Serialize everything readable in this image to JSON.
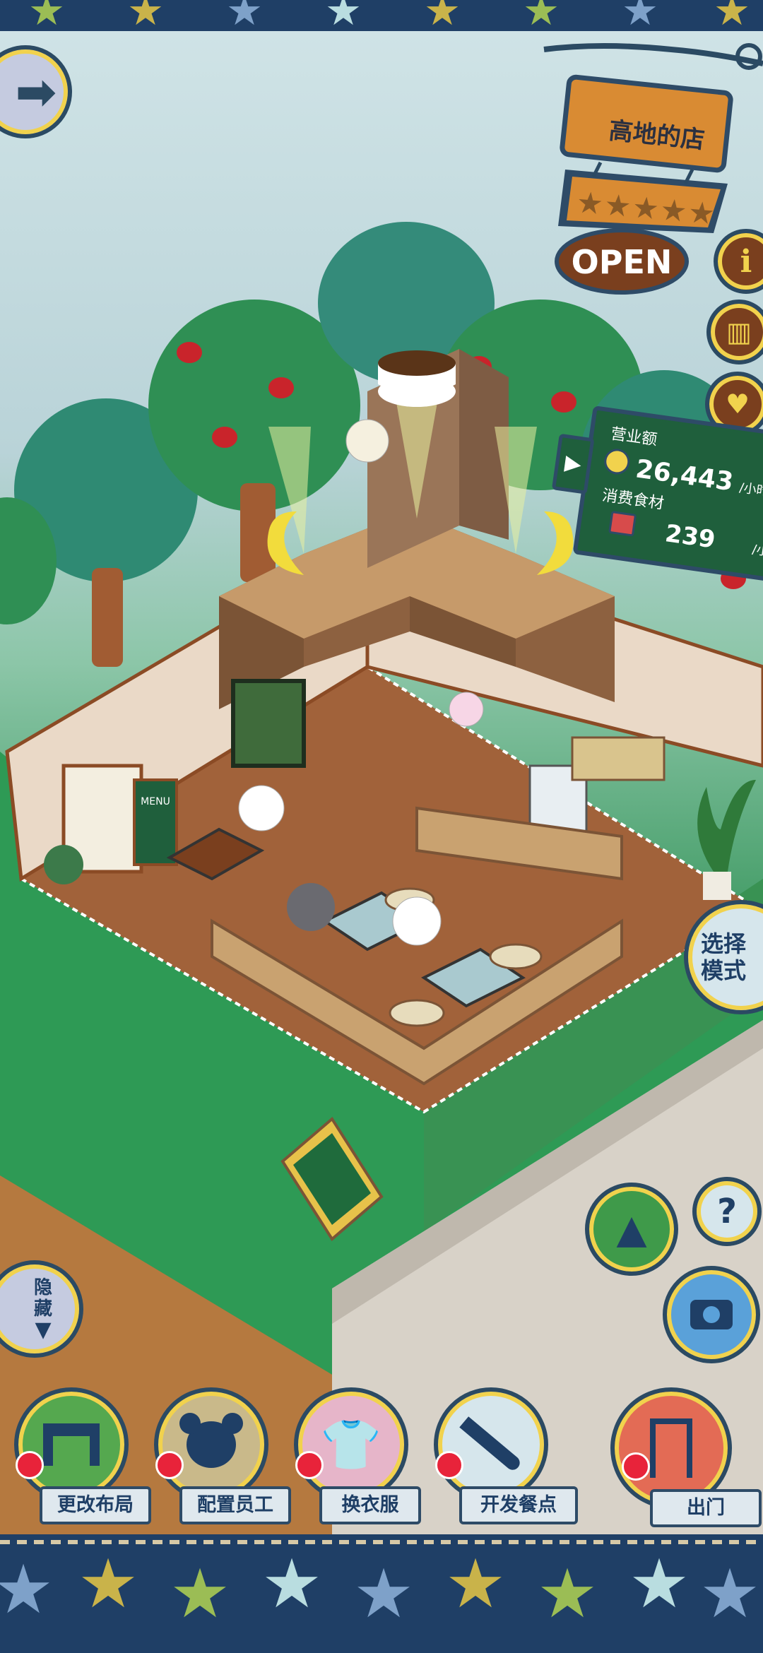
{
  "shop": {
    "name": "高地的店",
    "status": "OPEN",
    "stars": 5
  },
  "stats": {
    "revenue_label": "营业额",
    "revenue_value": "26,443",
    "revenue_unit": "/小时",
    "ingredients_label": "消费食材",
    "ingredients_value": "239",
    "ingredients_unit": "/小时"
  },
  "side_buttons": {
    "select_mode": "选择模式",
    "hide": "隐藏"
  },
  "bottom_menu": [
    {
      "label": "更改布局",
      "icon": "table-icon"
    },
    {
      "label": "配置员工",
      "icon": "bear-icon"
    },
    {
      "label": "换衣服",
      "icon": "shirt-icon"
    },
    {
      "label": "开发餐点",
      "icon": "knife-icon"
    },
    {
      "label": "出门",
      "icon": "door-icon"
    }
  ],
  "scene": {
    "menu_board": "MENU"
  },
  "colors": {
    "navy": "#1f3f66",
    "board_green": "#1f5f3c",
    "wood": "#d98b33",
    "gold": "#f1d24d"
  }
}
